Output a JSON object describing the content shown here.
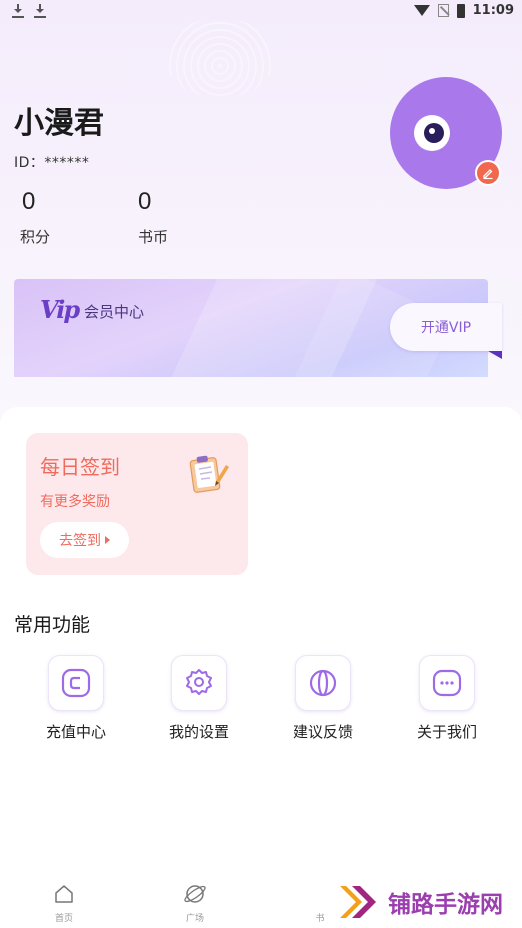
{
  "status_bar": {
    "time": "11:09",
    "left_icons": [
      "download-icon",
      "download-icon"
    ],
    "right_icons": [
      "wifi-icon",
      "sim-off-icon",
      "battery-icon"
    ]
  },
  "profile": {
    "nickname": "小漫君",
    "id_text": "ID：******",
    "stats": [
      {
        "value": "0",
        "label": "积分"
      },
      {
        "value": "0",
        "label": "书币"
      }
    ],
    "avatar_icon": "eye-avatar",
    "edit_icon": "edit-icon"
  },
  "vip": {
    "logo": "Vip",
    "title": "会员中心",
    "button": "开通VIP"
  },
  "checkin": {
    "title": "每日签到",
    "subtitle": "有更多奖励",
    "button": "去签到",
    "icon": "clipboard-icon"
  },
  "functions": {
    "title": "常用功能",
    "items": [
      {
        "label": "充值中心",
        "icon": "recharge-icon"
      },
      {
        "label": "我的设置",
        "icon": "settings-icon"
      },
      {
        "label": "建议反馈",
        "icon": "feedback-icon"
      },
      {
        "label": "关于我们",
        "icon": "about-icon"
      }
    ]
  },
  "bottom_nav": {
    "items": [
      {
        "label": "首页",
        "icon": "home-icon"
      },
      {
        "label": "广场",
        "icon": "planet-icon"
      },
      {
        "label": "书",
        "icon": "book-icon"
      }
    ]
  },
  "watermark": {
    "text": "铺路手游网",
    "icon": "double-chevron-logo"
  },
  "colors": {
    "accent_purple": "#a979ec",
    "checkin_red": "#ee6b5e",
    "checkin_bg": "#fde9ec",
    "watermark_purple": "#9b3fae",
    "watermark_orange": "#f3a01b"
  }
}
